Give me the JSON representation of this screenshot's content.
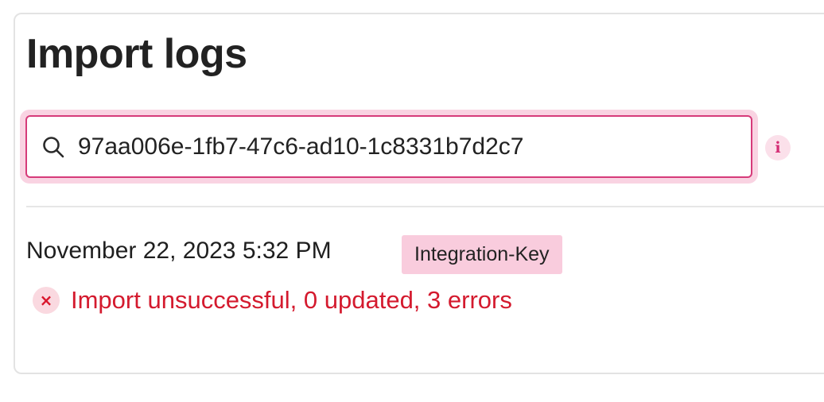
{
  "header": {
    "title": "Import logs"
  },
  "search": {
    "value": "97aa006e-1fb7-47c6-ad10-1c8331b7d2c7",
    "icon": "search-icon",
    "info_icon_glyph": "i"
  },
  "log": {
    "entries": [
      {
        "date": "November 22, 2023 5:32 PM",
        "badge": "Integration-Key",
        "status_icon_glyph": "×",
        "status_text": "Import unsuccessful, 0 updated, 3 errors"
      }
    ]
  },
  "colors": {
    "accent": "#d63b7a",
    "error": "#d41a2e",
    "badge_bg": "#f9ccdd"
  }
}
